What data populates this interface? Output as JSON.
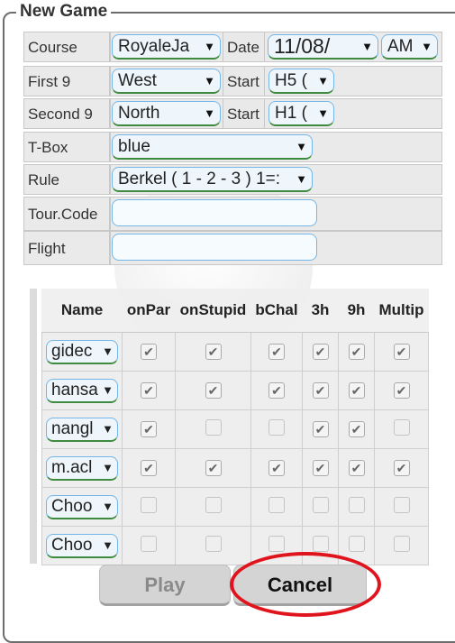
{
  "dialog": {
    "title": "New Game"
  },
  "fields": {
    "course_label": "Course",
    "course_value": "RoyaleJa",
    "date_label": "Date",
    "date_value": "11/08/",
    "ampm_value": "AM",
    "first9_label": "First 9",
    "first9_value": "West",
    "start1_label": "Start",
    "start1_value": "H5 (",
    "second9_label": "Second 9",
    "second9_value": "North",
    "start2_label": "Start",
    "start2_value": "H1 (",
    "tbox_label": "T-Box",
    "tbox_value": "blue",
    "rule_label": "Rule",
    "rule_value": "Berkel ( 1 - 2 - 3 ) 1=:",
    "tourcode_label": "Tour.Code",
    "tourcode_value": "",
    "flight_label": "Flight",
    "flight_value": ""
  },
  "players_table": {
    "headers": [
      "Name",
      "onPar",
      "onStupid",
      "bChal",
      "3h",
      "9h",
      "Multip"
    ],
    "rows": [
      {
        "name": "gidec",
        "checks": [
          true,
          true,
          true,
          true,
          true,
          true
        ]
      },
      {
        "name": "hansa",
        "checks": [
          true,
          true,
          true,
          true,
          true,
          true
        ]
      },
      {
        "name": "nangl",
        "checks": [
          true,
          false,
          false,
          true,
          true,
          false
        ]
      },
      {
        "name": "m.acl",
        "checks": [
          true,
          true,
          true,
          true,
          true,
          true
        ]
      },
      {
        "name": "Choo",
        "checks": [
          false,
          false,
          false,
          false,
          false,
          false
        ]
      },
      {
        "name": "Choo",
        "checks": [
          false,
          false,
          false,
          false,
          false,
          false
        ]
      }
    ]
  },
  "buttons": {
    "play": "Play",
    "cancel": "Cancel"
  },
  "colors": {
    "select_border": "#74b6e8",
    "select_underline": "#3e8a3e",
    "annotation_circle": "#e0141c",
    "play_text": "#8a8a8a",
    "cancel_text": "#111111"
  },
  "icons": {
    "dropdown": "dropdown-arrow-icon",
    "check": "checkmark-icon"
  }
}
